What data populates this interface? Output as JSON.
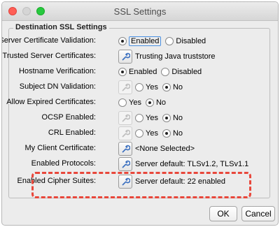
{
  "window": {
    "title": "SSL Settings"
  },
  "group": {
    "legend": "Destination SSL Settings"
  },
  "rows": [
    {
      "label": "Server Certificate Validation:",
      "type": "radio",
      "options": [
        "Enabled",
        "Disabled"
      ],
      "selected": 0
    },
    {
      "label": "Trusted Server Certificates:",
      "type": "button",
      "value": "Trusting Java truststore"
    },
    {
      "label": "Hostname Verification:",
      "type": "radio",
      "options": [
        "Enabled",
        "Disabled"
      ],
      "selected": 0
    },
    {
      "label": "Subject DN Validation:",
      "type": "button-radio",
      "options": [
        "Yes",
        "No"
      ],
      "selected": 1
    },
    {
      "label": "Allow Expired Certificates:",
      "type": "radio",
      "options": [
        "Yes",
        "No"
      ],
      "selected": 1
    },
    {
      "label": "OCSP Enabled:",
      "type": "button-radio",
      "options": [
        "Yes",
        "No"
      ],
      "selected": 1
    },
    {
      "label": "CRL Enabled:",
      "type": "button-radio",
      "options": [
        "Yes",
        "No"
      ],
      "selected": 1
    },
    {
      "label": "My Client Certificate:",
      "type": "button",
      "value": "<None Selected>"
    },
    {
      "label": "Enabled Protocols:",
      "type": "button",
      "value": "Server default: TLSv1.2, TLSv1.1"
    },
    {
      "label": "Enabled Cipher Suites:",
      "type": "button",
      "value": "Server default: 22 enabled"
    }
  ],
  "buttons": {
    "ok": "OK",
    "cancel": "Cancel"
  },
  "colors": {
    "highlight": "#e8473b",
    "close": "#ff5f56",
    "zoom": "#27c93f"
  }
}
